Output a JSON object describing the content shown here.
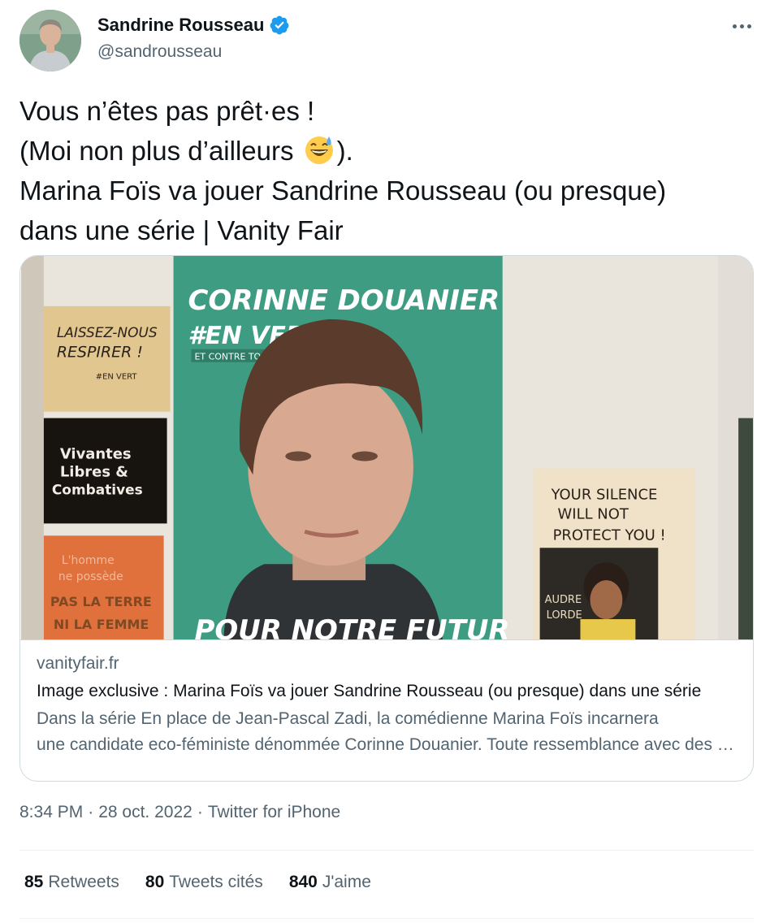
{
  "author": {
    "name": "Sandrine Rousseau",
    "handle": "@sandrousseau",
    "avatar_icon": "profile-photo",
    "verified_icon": "verified-badge-icon"
  },
  "tweet": {
    "lines": [
      "Vous n’êtes pas prêt·es !",
      "(Moi non plus d’ailleurs",
      ").",
      "Marina Foïs va jouer Sandrine Rousseau (ou presque)",
      "dans une série | Vanity Fair"
    ],
    "emoji_icon": "grinning-face-with-sweat-emoji"
  },
  "card": {
    "domain": "vanityfair.fr",
    "title": "Image exclusive : Marina Foïs va jouer Sandrine Rousseau (ou presque) dans une série",
    "description_line1": "Dans la série En place de Jean-Pascal Zadi, la comédienne Marina Foïs incarnera",
    "description_line2": "une candidate eco-féministe dénommée Corinne Douanier. Toute ressemblance avec des personnes existantes",
    "image": {
      "poster_name": "CORINNE DOUANIER",
      "poster_slogan": "#EN VERT",
      "poster_subslogan": "ET CONTRE TOUS",
      "poster_bottom": "POUR NOTRE FUTUR",
      "sign1_line1": "LAISSEZ-NOUS",
      "sign1_line2": "RESPIRER !",
      "sign1_small": "#EN VERT",
      "sign2_line1": "Vivantes",
      "sign2_line2": "Libres &",
      "sign2_line3": "Combatives",
      "sign3_line1": "L'homme",
      "sign3_line2": "ne possède",
      "sign3_line3": "PAS LA TERRE",
      "sign3_line4": "NI LA FEMME",
      "sign4_line1": "YOUR SILENCE",
      "sign4_line2": "WILL NOT",
      "sign4_line3": "PROTECT YOU !",
      "sign4_name1": "AUDRE",
      "sign4_name2": "LORDE"
    }
  },
  "meta": {
    "time": "8:34 PM",
    "date": "28 oct. 2022",
    "source": "Twitter for iPhone"
  },
  "stats": {
    "retweets_count": "85",
    "retweets_label": "Retweets",
    "quotes_count": "80",
    "quotes_label": "Tweets cités",
    "likes_count": "840",
    "likes_label": "J'aime"
  },
  "colors": {
    "text": "#0f1419",
    "secondary": "#536471",
    "verified": "#1d9bf0",
    "poster_green": "#3d9c82"
  }
}
